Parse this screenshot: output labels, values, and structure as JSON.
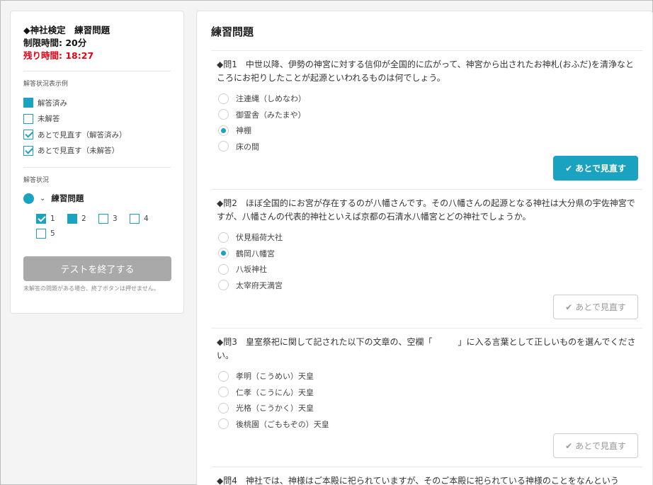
{
  "sidebar": {
    "exam_title": "◆神社検定　練習問題",
    "time_limit": "制限時間: 20分",
    "time_left": "残り時間: 18:27",
    "legend_heading": "解答状況表示例",
    "legend": [
      {
        "label": "解答済み"
      },
      {
        "label": "未解答"
      },
      {
        "label": "あとで見直す（解答済み）"
      },
      {
        "label": "あとで見直す（未解答）"
      }
    ],
    "status_heading": "解答状況",
    "tree_title": "練習問題",
    "question_numbers": [
      "1",
      "2",
      "3",
      "4",
      "5"
    ],
    "finish_button": "テストを終了する",
    "finish_note": "未解答の問題がある場合、終了ボタンは押せません。"
  },
  "main": {
    "title": "練習問題",
    "flag_label": "あとで見直す",
    "questions": [
      {
        "text": "◆問1　中世以降、伊勢の神宮に対する信仰が全国的に広がって、神宮から出されたお神札(おふだ)を清浄なところにお祀りしたことが起源といわれるものは何でしょう。",
        "options": [
          "注連縄（しめなわ）",
          "御霊舎（みたまや）",
          "神棚",
          "床の間"
        ],
        "selected_index": 2,
        "flagged": true
      },
      {
        "text": "◆問2　ほぼ全国的にお宮が存在するのが八幡さんです。その八幡さんの起源となる神社は大分県の宇佐神宮ですが、八幡さんの代表的神社といえば京都の石清水八幡宮とどの神社でしょうか。",
        "options": [
          "伏見稲荷大社",
          "鶴岡八幡宮",
          "八坂神社",
          "太宰府天満宮"
        ],
        "selected_index": 1,
        "flagged": false
      },
      {
        "text": "◆問3　皇室祭祀に関して記された以下の文章の、空欄「　　　」に入る言葉として正しいものを選んでください。",
        "options": [
          "孝明（こうめい）天皇",
          "仁孝（こうにん）天皇",
          "光格（こうかく）天皇",
          "後桃園（ごももぞの）天皇"
        ],
        "selected_index": -1,
        "flagged": false
      },
      {
        "text": "◆問4　神社では、神様はご本殿に祀られていますが、そのご本殿に祀られている神様のことをなんという"
      }
    ]
  },
  "colors": {
    "accent": "#1aa3c1",
    "time_left": "#e60012",
    "finish_disabled": "#a9a9a9"
  }
}
